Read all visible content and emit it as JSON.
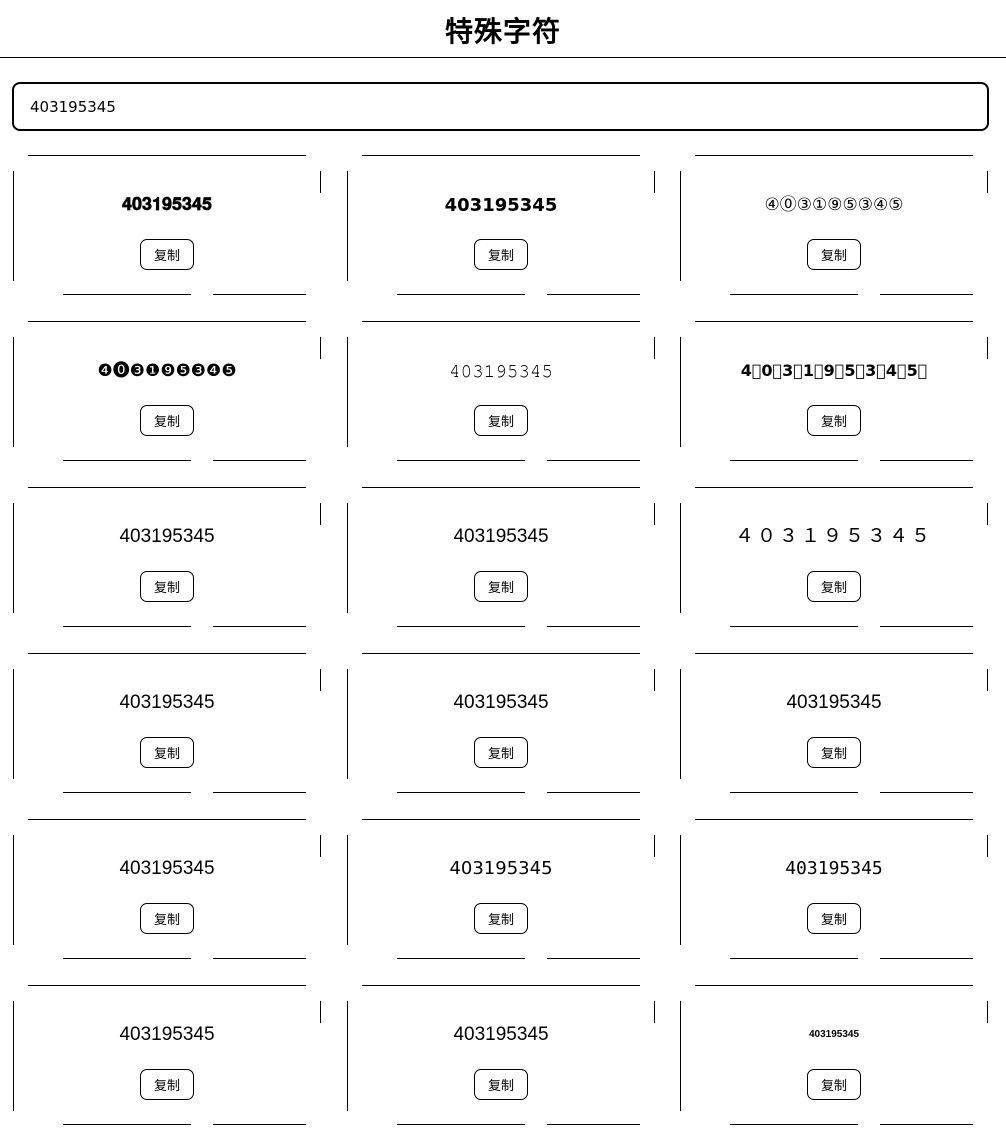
{
  "header": {
    "title": "特殊字符"
  },
  "search": {
    "value": "403195345"
  },
  "copy_label": "复制",
  "cards": [
    {
      "text": "𝟒𝟎𝟑𝟏𝟗𝟓𝟑𝟒𝟓",
      "style": "bold"
    },
    {
      "text": "𝟰𝟬𝟯𝟭𝟵𝟱𝟯𝟰𝟱",
      "style": "bold-sans"
    },
    {
      "text": "④⓪③①⑨⑤③④⑤",
      "style": "circled"
    },
    {
      "text": "❹⓿❸❶❾❺❸❹❺",
      "style": "negative-circled"
    },
    {
      "text": "𝟺𝟶𝟹𝟷𝟿𝟻𝟹𝟺𝟻",
      "style": "serif"
    },
    {
      "text": "4⃣0⃣3⃣1⃣9⃣5⃣3⃣4⃣5⃣",
      "style": "squared"
    },
    {
      "text": "403195345",
      "style": "plain"
    },
    {
      "text": "403195345",
      "style": "plain"
    },
    {
      "text": "４０３１９５３４５",
      "style": "fullwidth"
    },
    {
      "text": "403195345",
      "style": "plain"
    },
    {
      "text": "403195345",
      "style": "plain"
    },
    {
      "text": "403195345",
      "style": "plain"
    },
    {
      "text": "403195345",
      "style": "plain"
    },
    {
      "text": "403195345",
      "style": "plain2"
    },
    {
      "text": "403195345",
      "style": "mono"
    },
    {
      "text": "403195345",
      "style": "plain"
    },
    {
      "text": "403195345",
      "style": "plain"
    },
    {
      "text": "403195345",
      "style": "tiny"
    }
  ]
}
